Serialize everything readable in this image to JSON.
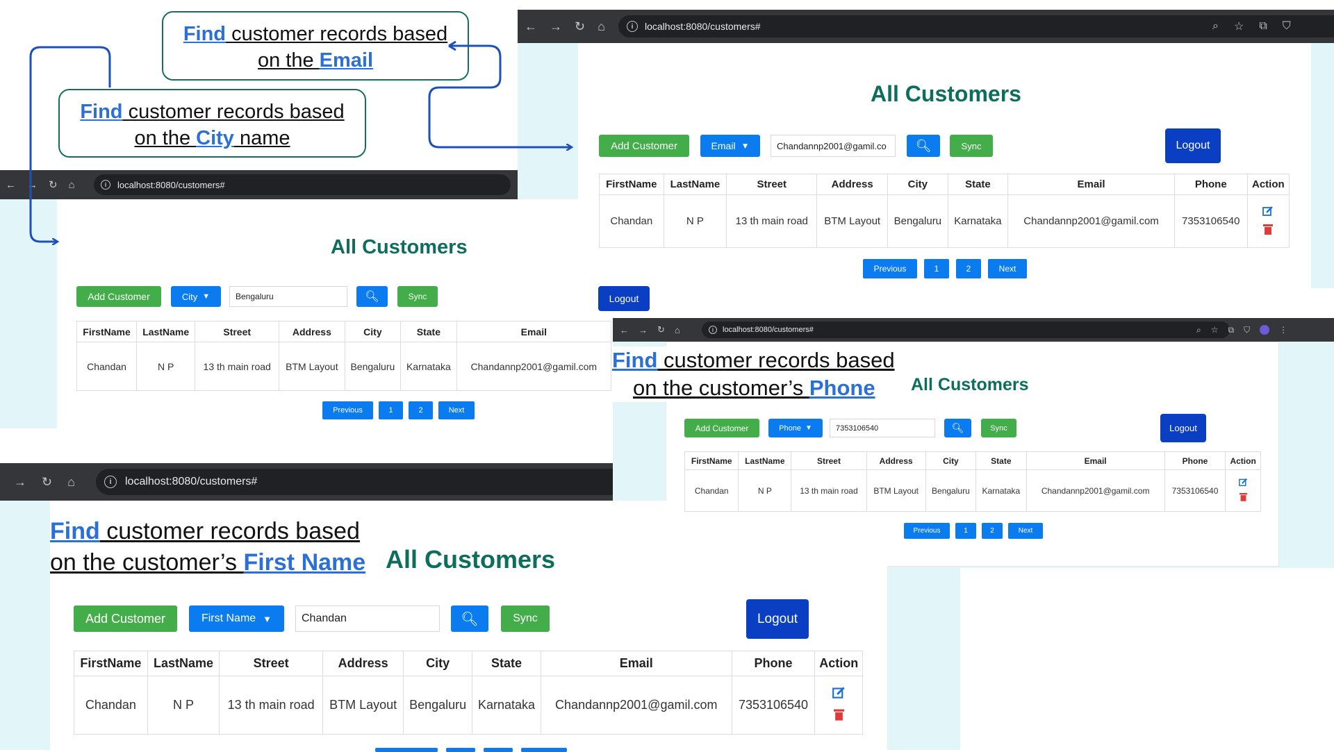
{
  "common": {
    "url": "localhost:8080/customers#",
    "title": "All Customers",
    "add_label": "Add Customer",
    "sync_label": "Sync",
    "logout_label": "Logout",
    "prev_label": "Previous",
    "page1": "1",
    "page2": "2",
    "next_label": "Next",
    "headers": [
      "FirstName",
      "LastName",
      "Street",
      "Address",
      "City",
      "State",
      "Email",
      "Phone",
      "Action"
    ],
    "row": [
      "Chandan",
      "N P",
      "13 th main road",
      "BTM Layout",
      "Bengaluru",
      "Karnataka",
      "Chandannp2001@gamil.com",
      "7353106540"
    ],
    "colors": {
      "title": "#0e6e5e",
      "green": "#43ad4a",
      "blue": "#0b7bf0",
      "navy": "#0a3fc4",
      "link": "#2b6fd8",
      "edit": "#1a6fd8",
      "delete": "#e03b3b"
    }
  },
  "panels": {
    "email": {
      "filter": "Email",
      "search_value": "Chandannp2001@gamil.co"
    },
    "city": {
      "filter": "City",
      "search_value": "Bengaluru"
    },
    "phone": {
      "filter": "Phone",
      "search_value": "7353106540"
    },
    "firstname": {
      "filter": "First Name",
      "search_value": "Chandan"
    }
  },
  "stray_logout": "Logout",
  "captions": {
    "email": {
      "kw1": "Find",
      "text1": " customer records based ",
      "text2": "on the ",
      "kw2": "Email"
    },
    "city": {
      "kw1": "Find",
      "text1": " customer records based ",
      "text2": "on the ",
      "kw2": "City",
      "text3": " name"
    },
    "phone": {
      "kw1": "Find",
      "text1": " customer records based ",
      "text2": "on the  customer’s ",
      "kw2": "Phone"
    },
    "firstname": {
      "kw1": "Find",
      "text1": " customer records based ",
      "text2": "on the  customer’s ",
      "kw2": "First Name"
    }
  },
  "icons": {
    "back": "back-arrow-icon",
    "forward": "forward-arrow-icon",
    "reload": "reload-icon",
    "home": "home-icon",
    "info": "site-info-icon",
    "search": "search-icon",
    "edit": "edit-icon",
    "delete": "trash-icon",
    "chevron": "chevron-down-icon"
  }
}
